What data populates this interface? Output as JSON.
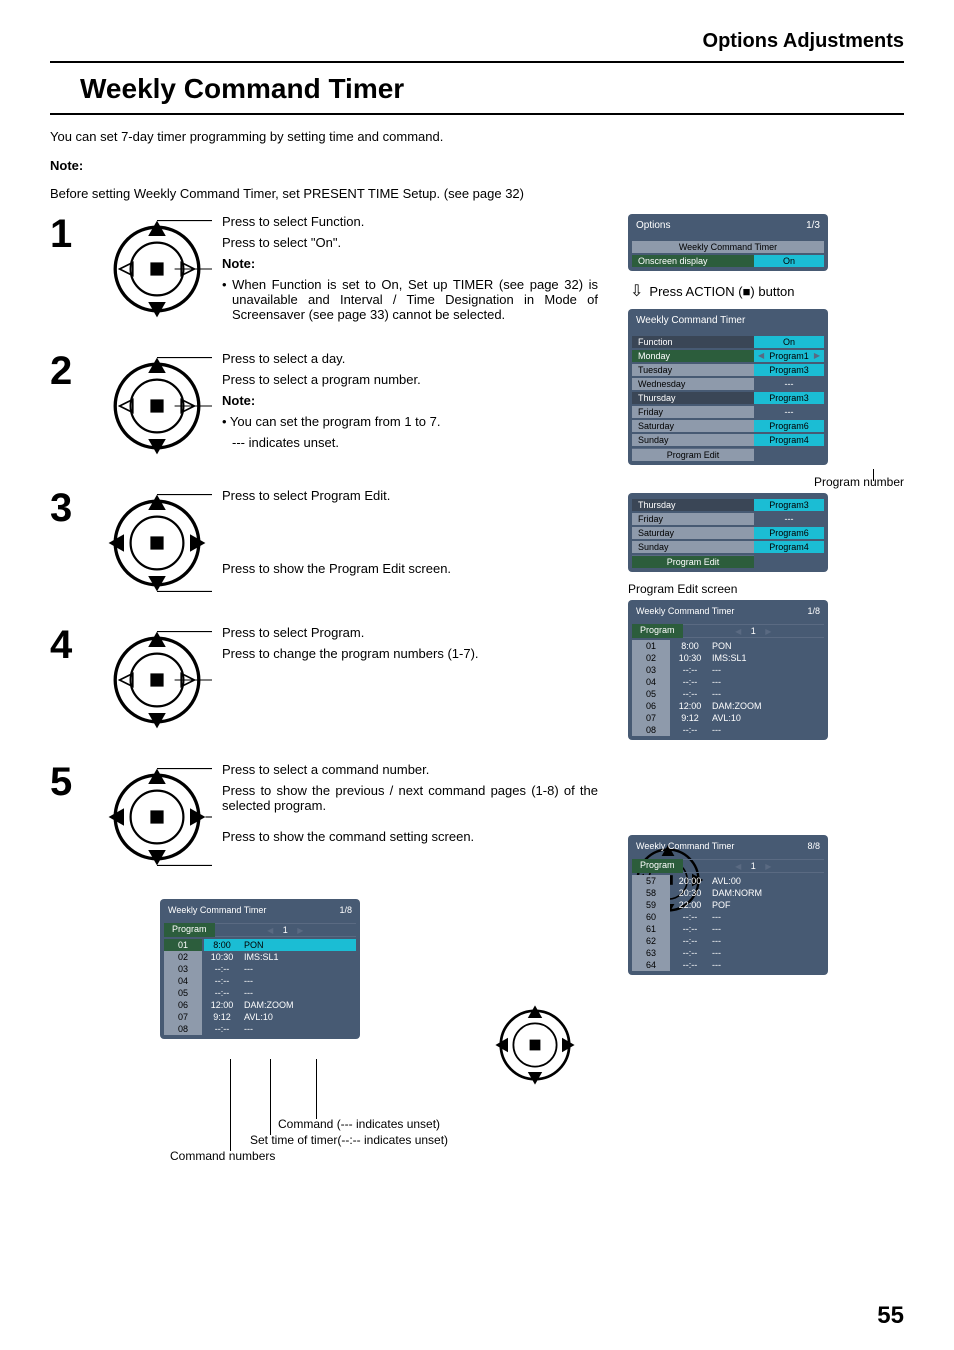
{
  "header": {
    "breadcrumb": "Options Adjustments"
  },
  "title": "Weekly Command Timer",
  "intro": "You can set 7-day timer programming by setting time and command.",
  "pre_note": {
    "label": "Note:",
    "body": "Before setting Weekly Command Timer, set PRESENT TIME Setup. (see page 32)"
  },
  "steps": {
    "s1": {
      "num": "1",
      "l1": "Press to select Function.",
      "l2": "Press to select \"On\".",
      "note_label": "Note:",
      "note_body": "• When Function is set to On, Set up TIMER (see page 32) is unavailable and Interval / Time Designation in Mode of Screensaver (see page 33) cannot be selected."
    },
    "s2": {
      "num": "2",
      "l1": "Press to select a day.",
      "l2": "Press to select a program number.",
      "note_label": "Note:",
      "note_b1": "• You can set the program from 1 to 7.",
      "note_b2": "--- indicates unset."
    },
    "s3": {
      "num": "3",
      "l1": "Press to select Program Edit.",
      "l2": "Press to show the Program Edit screen."
    },
    "s4": {
      "num": "4",
      "l1": "Press to select Program.",
      "l2": "Press to change the program numbers (1-7)."
    },
    "s5": {
      "num": "5",
      "l1": "Press to select a command number.",
      "l2": "Press to show the previous / next command pages (1-8) of the selected program.",
      "l3": "Press to show the command setting screen."
    }
  },
  "right": {
    "options_panel": {
      "title": "Options",
      "page": "1/3",
      "rows": [
        {
          "label": "Weekly Command Timer",
          "val": ""
        },
        {
          "label": "Onscreen display",
          "val": "On"
        }
      ]
    },
    "action_line": "Press ACTION (■) button",
    "wct_panel": {
      "title": "Weekly Command Timer",
      "rows": [
        {
          "label": "Function",
          "val": "On",
          "dark": true
        },
        {
          "label": "Monday",
          "val": "Program1",
          "green": true,
          "arrows": true
        },
        {
          "label": "Tuesday",
          "val": "Program3"
        },
        {
          "label": "Wednesday",
          "val": "---",
          "dim": true
        },
        {
          "label": "Thursday",
          "val": "Program3",
          "dark": true
        },
        {
          "label": "Friday",
          "val": "---",
          "dim": true
        },
        {
          "label": "Saturday",
          "val": "Program6"
        },
        {
          "label": "Sunday",
          "val": "Program4"
        }
      ],
      "program_edit": "Program Edit"
    },
    "program_number_label": "Program number",
    "wct_sub_panel": {
      "rows": [
        {
          "label": "Thursday",
          "val": "Program3",
          "dark": true
        },
        {
          "label": "Friday",
          "val": "---",
          "dim": true
        },
        {
          "label": "Saturday",
          "val": "Program6"
        },
        {
          "label": "Sunday",
          "val": "Program4"
        }
      ],
      "program_edit": "Program Edit",
      "program_edit_green": true
    },
    "program_edit_screen_label": "Program Edit screen",
    "ped_panel": {
      "title": "Weekly Command Timer",
      "page": "1/8",
      "program_label": "Program",
      "program_val": "1",
      "rows": [
        {
          "idx": "01",
          "time": "8:00",
          "cmd": "PON"
        },
        {
          "idx": "02",
          "time": "10:30",
          "cmd": "IMS:SL1"
        },
        {
          "idx": "03",
          "time": "--:--",
          "cmd": "---"
        },
        {
          "idx": "04",
          "time": "--:--",
          "cmd": "---"
        },
        {
          "idx": "05",
          "time": "--:--",
          "cmd": "---"
        },
        {
          "idx": "06",
          "time": "12:00",
          "cmd": "DAM:ZOOM"
        },
        {
          "idx": "07",
          "time": "9:12",
          "cmd": "AVL:10"
        },
        {
          "idx": "08",
          "time": "--:--",
          "cmd": "---"
        }
      ]
    }
  },
  "bottom": {
    "ped_left": {
      "title": "Weekly Command Timer",
      "page": "1/8",
      "program_label": "Program",
      "program_val": "1",
      "rows": [
        {
          "idx": "01",
          "time": "8:00",
          "cmd": "PON",
          "hl": true
        },
        {
          "idx": "02",
          "time": "10:30",
          "cmd": "IMS:SL1"
        },
        {
          "idx": "03",
          "time": "--:--",
          "cmd": "---"
        },
        {
          "idx": "04",
          "time": "--:--",
          "cmd": "---"
        },
        {
          "idx": "05",
          "time": "--:--",
          "cmd": "---"
        },
        {
          "idx": "06",
          "time": "12:00",
          "cmd": "DAM:ZOOM"
        },
        {
          "idx": "07",
          "time": "9:12",
          "cmd": "AVL:10"
        },
        {
          "idx": "08",
          "time": "--:--",
          "cmd": "---"
        }
      ]
    },
    "callout_cmd": "Command (--- indicates unset)",
    "callout_time": "Set time of timer(--:-- indicates unset)",
    "callout_idx": "Command numbers",
    "ped_right": {
      "title": "Weekly Command Timer",
      "page": "8/8",
      "program_label": "Program",
      "program_val": "1",
      "rows": [
        {
          "idx": "57",
          "time": "20:00",
          "cmd": "AVL:00"
        },
        {
          "idx": "58",
          "time": "20:30",
          "cmd": "DAM:NORM"
        },
        {
          "idx": "59",
          "time": "22:00",
          "cmd": "POF"
        },
        {
          "idx": "60",
          "time": "--:--",
          "cmd": "---"
        },
        {
          "idx": "61",
          "time": "--:--",
          "cmd": "---"
        },
        {
          "idx": "62",
          "time": "--:--",
          "cmd": "---"
        },
        {
          "idx": "63",
          "time": "--:--",
          "cmd": "---"
        },
        {
          "idx": "64",
          "time": "--:--",
          "cmd": "---"
        }
      ]
    }
  },
  "page_number": "55"
}
